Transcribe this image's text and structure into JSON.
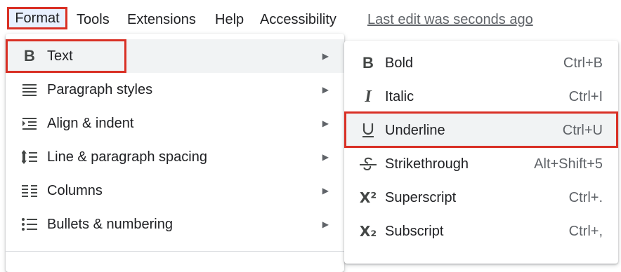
{
  "menubar": {
    "items": [
      "Format",
      "Tools",
      "Extensions",
      "Help",
      "Accessibility"
    ],
    "last_edit": "Last edit was seconds ago"
  },
  "format_menu": {
    "items": [
      {
        "label": "Text",
        "icon": "bold-b-icon"
      },
      {
        "label": "Paragraph styles",
        "icon": "paragraph-styles-icon"
      },
      {
        "label": "Align & indent",
        "icon": "indent-icon"
      },
      {
        "label": "Line & paragraph spacing",
        "icon": "line-spacing-icon"
      },
      {
        "label": "Columns",
        "icon": "columns-icon"
      },
      {
        "label": "Bullets & numbering",
        "icon": "bullets-icon"
      }
    ]
  },
  "text_submenu": {
    "items": [
      {
        "label": "Bold",
        "shortcut": "Ctrl+B",
        "icon": "bold-icon"
      },
      {
        "label": "Italic",
        "shortcut": "Ctrl+I",
        "icon": "italic-icon"
      },
      {
        "label": "Underline",
        "shortcut": "Ctrl+U",
        "icon": "underline-icon"
      },
      {
        "label": "Strikethrough",
        "shortcut": "Alt+Shift+5",
        "icon": "strikethrough-icon"
      },
      {
        "label": "Superscript",
        "shortcut": "Ctrl+.",
        "icon": "superscript-icon"
      },
      {
        "label": "Subscript",
        "shortcut": "Ctrl+,",
        "icon": "subscript-icon"
      }
    ]
  },
  "colors": {
    "highlight_border": "#d93025",
    "hover_bg": "#f1f3f4",
    "active_menu_bg": "#e8f0fe"
  }
}
